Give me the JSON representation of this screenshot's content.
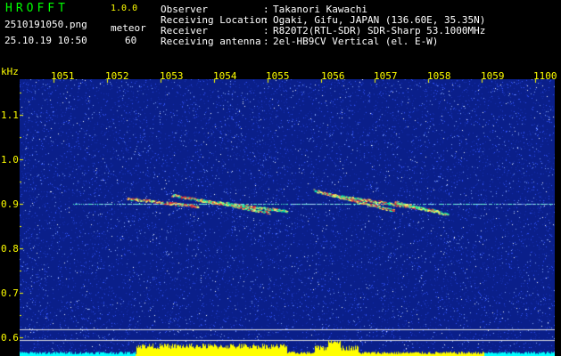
{
  "header": {
    "logo": "HROFFT",
    "version": "1.0.0",
    "filename": "2510191050.png",
    "datetime": "25.10.19 10:50",
    "meteor_label": "meteor",
    "meteor_count": "60",
    "fields": [
      {
        "label": "Observer",
        "sep": ":",
        "value": "Takanori Kawachi"
      },
      {
        "label": "Receiving Location",
        "sep": ":",
        "value": "Ogaki, Gifu, JAPAN (136.60E, 35.35N)"
      },
      {
        "label": "Receiver",
        "sep": ":",
        "value": "R820T2(RTL-SDR) SDR-Sharp 53.1000MHz"
      },
      {
        "label": "Receiving antenna",
        "sep": ":",
        "value": "2el-HB9CV Vertical (el. E-W)"
      }
    ]
  },
  "axes": {
    "y_unit": "kHz",
    "x_ticks": [
      "1051",
      "1052",
      "1053",
      "1054",
      "1055",
      "1056",
      "1057",
      "1058",
      "1059",
      "1100"
    ],
    "y_ticks": [
      "1.1",
      "1.0",
      "0.9",
      "0.8",
      "0.7",
      "0.6"
    ]
  },
  "colors": {
    "background": "#000000",
    "spectrogram_base": "#0a1f8a",
    "noise": "#3355ff",
    "signal_hot": "#ff3030",
    "signal_mid": "#00ffaa",
    "amplitude": "#ffff00",
    "amplitude_low": "#00ffff",
    "text_label": "#ffff00",
    "text_value": "#ffffff"
  }
}
